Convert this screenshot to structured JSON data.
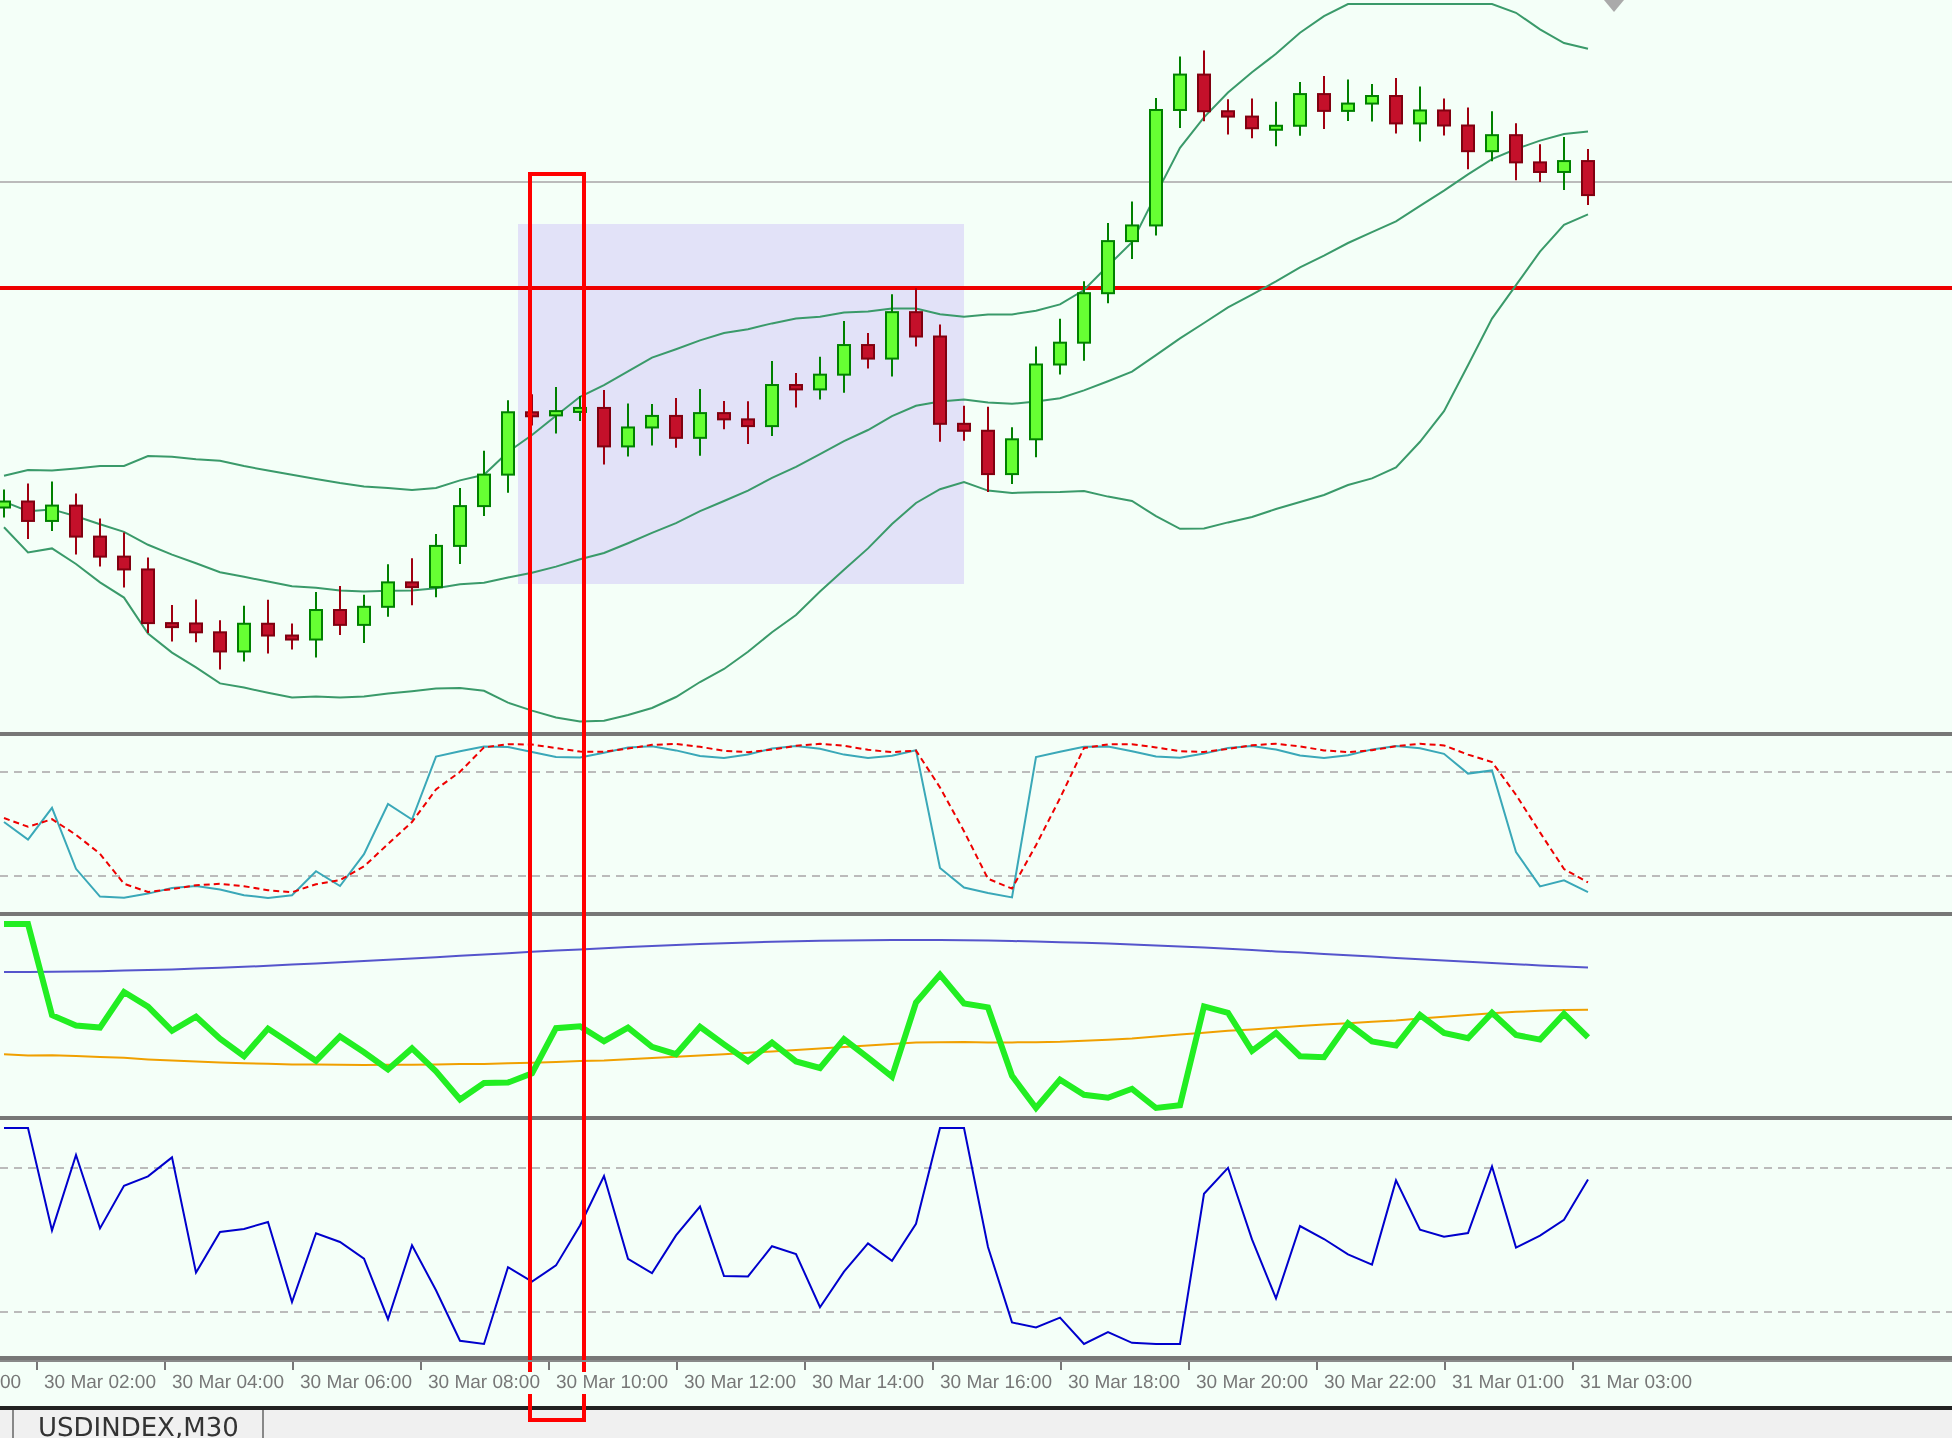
{
  "time_axis": {
    "labels": [
      "00",
      "30 Mar 02:00",
      "30 Mar 04:00",
      "30 Mar 06:00",
      "30 Mar 08:00",
      "30 Mar 10:00",
      "30 Mar 12:00",
      "30 Mar 14:00",
      "30 Mar 16:00",
      "30 Mar 18:00",
      "30 Mar 20:00",
      "30 Mar 22:00",
      "31 Mar 01:00",
      "31 Mar 03:00"
    ]
  },
  "tab": {
    "label": "USDINDEX,M30"
  }
}
